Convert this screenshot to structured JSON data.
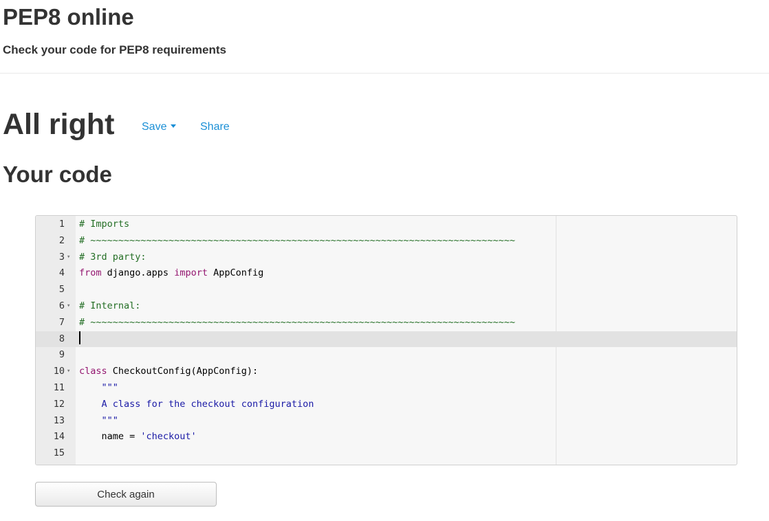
{
  "header": {
    "title": "PEP8 online",
    "subtitle": "Check your code for PEP8 requirements"
  },
  "result": {
    "title": "All right",
    "save_label": "Save",
    "share_label": "Share"
  },
  "code_section": {
    "title": "Your code"
  },
  "editor": {
    "active_line": 8,
    "lines": [
      {
        "n": "1",
        "text": "# Imports"
      },
      {
        "n": "2",
        "text": "# ~~~~~~~~~~~~~~~~~~~~~~~~~~~~~~~~~~~~~~~~~~~~~~~~~~~~~~~~~~~~~~~~~~~~~~~~~~~~"
      },
      {
        "n": "3",
        "text": "# 3rd party:"
      },
      {
        "n": "4",
        "text": "from django.apps import AppConfig"
      },
      {
        "n": "5",
        "text": ""
      },
      {
        "n": "6",
        "text": "# Internal:"
      },
      {
        "n": "7",
        "text": "# ~~~~~~~~~~~~~~~~~~~~~~~~~~~~~~~~~~~~~~~~~~~~~~~~~~~~~~~~~~~~~~~~~~~~~~~~~~~~"
      },
      {
        "n": "8",
        "text": ""
      },
      {
        "n": "9",
        "text": ""
      },
      {
        "n": "10",
        "text": "class CheckoutConfig(AppConfig):"
      },
      {
        "n": "11",
        "text": "    \"\"\""
      },
      {
        "n": "12",
        "text": "    A class for the checkout configuration"
      },
      {
        "n": "13",
        "text": "    \"\"\""
      },
      {
        "n": "14",
        "text": "    name = 'checkout'"
      },
      {
        "n": "15",
        "text": ""
      }
    ]
  },
  "actions": {
    "check_again_label": "Check again"
  }
}
